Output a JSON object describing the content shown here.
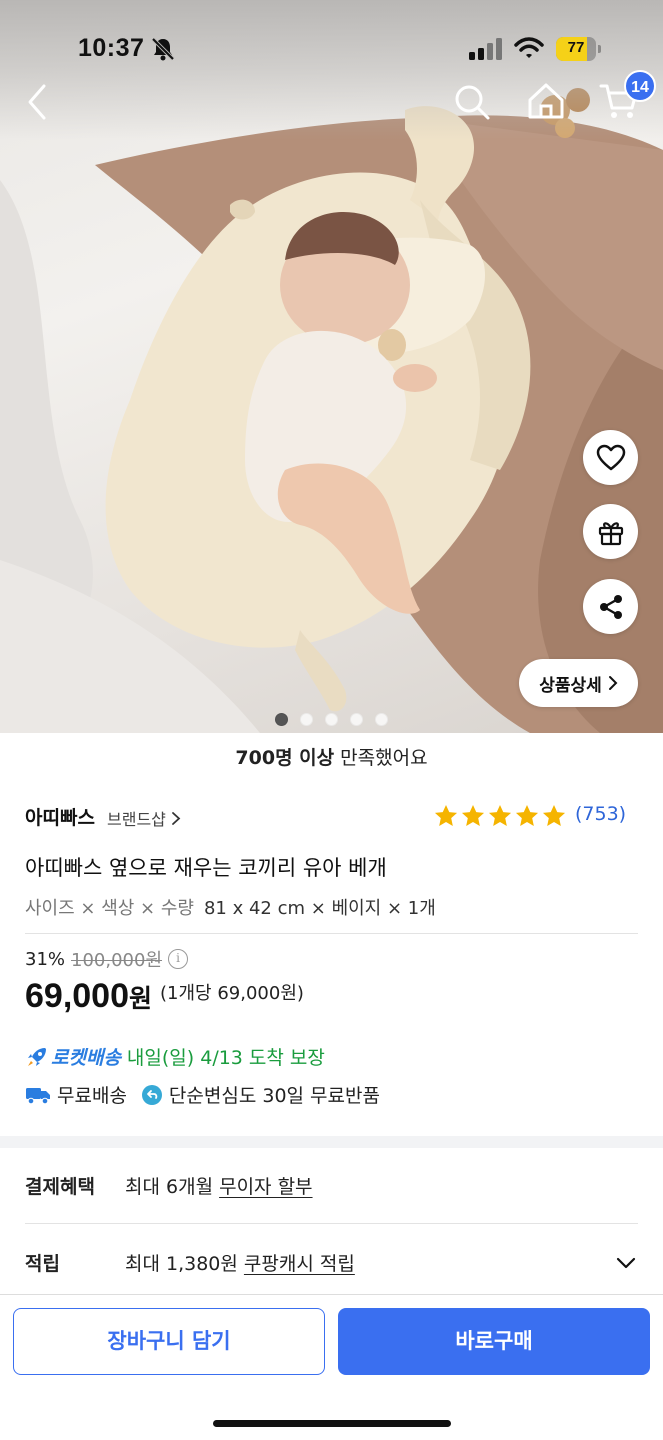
{
  "status_bar": {
    "time": "10:37",
    "battery": "77",
    "battery_level_percent": 77
  },
  "nav": {
    "cart_count": "14"
  },
  "image": {
    "detail_button": "상품상세",
    "slide_count": 5,
    "active_slide": 1
  },
  "satisfaction": {
    "strong": "700명 이상",
    "rest": " 만족했어요"
  },
  "brand": {
    "name": "아띠빠스",
    "shop_link": "브랜드샵",
    "rating_stars": 5,
    "review_count": "(753)"
  },
  "product": {
    "title": "아띠빠스 옆으로 재우는 코끼리 유아 베개",
    "option_label": "사이즈 × 색상 × 수량",
    "option_value": "81 x 42 cm × 베이지 × 1개"
  },
  "pricing": {
    "discount": "31%",
    "original": "100,000원",
    "price": "69,000",
    "currency": "원",
    "unit_price": "(1개당 69,000원)"
  },
  "delivery": {
    "rocket_label": "로켓배송",
    "rocket_text": "내일(일) 4/13 도착 보장",
    "free_shipping": "무료배송",
    "free_return": "단순변심도 30일 무료반품"
  },
  "benefits": {
    "payment_label": "결제혜택",
    "payment_prefix": "최대 6개월 ",
    "payment_link": "무이자 할부",
    "points_label": "적립",
    "points_prefix": "최대 1,380원 ",
    "points_link": "쿠팡캐시 적립"
  },
  "bottom": {
    "add_to_cart": "장바구니 담기",
    "buy_now": "바로구매"
  },
  "colors": {
    "accent": "#3a6ff0",
    "rocket_green": "#1a9c3e",
    "star": "#f5b400",
    "review_blue": "#2e65d8"
  }
}
